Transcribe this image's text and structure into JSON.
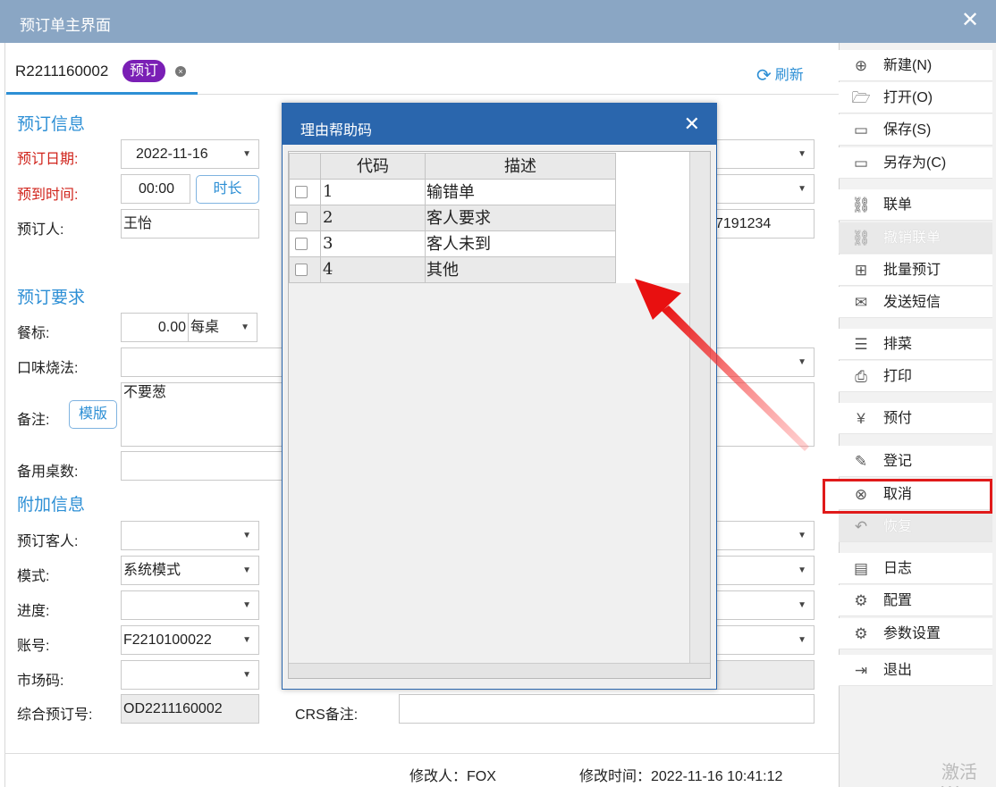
{
  "window": {
    "title": "预订单主界面",
    "close_glyph": "✕"
  },
  "tab": {
    "order_no": "R2211160002",
    "status": "预订",
    "close_glyph": "×"
  },
  "refresh_label": "刷新",
  "sections": {
    "info": "预订信息",
    "require": "预订要求",
    "extra": "附加信息"
  },
  "form": {
    "date_label": "预订日期:",
    "date_value": "2022-11-16",
    "arrive_label": "预到时间:",
    "arrive_value": "00:00",
    "duration_btn": "时长",
    "booker_label": "预订人:",
    "booker_value": "王怡",
    "phone_value": "7191234",
    "meal_label": "餐标:",
    "meal_value": "0.00",
    "meal_unit": "每桌",
    "taste_label": "口味烧法:",
    "remark_label": "备注:",
    "template_btn": "模版",
    "remark_value": "不要葱",
    "spare_label": "备用桌数:",
    "guest_label": "预订客人:",
    "mode_label": "模式:",
    "mode_value": "系统模式",
    "progress_label": "进度:",
    "account_label": "账号:",
    "account_value": "F2210100022",
    "market_label": "市场码:",
    "combo_label": "综合预订号:",
    "combo_value": "OD2211160002",
    "crs_label": "CRS备注:"
  },
  "footer": {
    "modifier": "修改人：FOX",
    "modified_time": "修改时间：2022-11-16 10:41:12"
  },
  "watermark": "激活 W",
  "sidebar": [
    {
      "label": "新建(N)",
      "icon": "⊕",
      "icon_name": "plus-circle-icon",
      "disabled": false
    },
    {
      "label": "打开(O)",
      "icon": "🗁",
      "icon_name": "folder-open-icon",
      "disabled": false
    },
    {
      "label": "保存(S)",
      "icon": "▭",
      "icon_name": "save-icon",
      "disabled": false
    },
    {
      "label": "另存为(C)",
      "icon": "▭",
      "icon_name": "save-as-icon",
      "disabled": false
    },
    {
      "label": "联单",
      "icon": "⛓",
      "icon_name": "link-icon",
      "disabled": false
    },
    {
      "label": "撤销联单",
      "icon": "⛓",
      "icon_name": "unlink-icon",
      "disabled": true
    },
    {
      "label": "批量预订",
      "icon": "⊞",
      "icon_name": "batch-icon",
      "disabled": false
    },
    {
      "label": "发送短信",
      "icon": "✉",
      "icon_name": "mail-icon",
      "disabled": false
    },
    {
      "label": "排菜",
      "icon": "☰",
      "icon_name": "menu-list-icon",
      "disabled": false
    },
    {
      "label": "打印",
      "icon": "⎙",
      "icon_name": "print-icon",
      "disabled": false
    },
    {
      "label": "预付",
      "icon": "¥",
      "icon_name": "prepay-icon",
      "disabled": false
    },
    {
      "label": "登记",
      "icon": "✎",
      "icon_name": "register-icon",
      "disabled": false
    },
    {
      "label": "取消",
      "icon": "⊗",
      "icon_name": "cancel-circle-icon",
      "disabled": false
    },
    {
      "label": "恢复",
      "icon": "↶",
      "icon_name": "restore-icon",
      "disabled": true
    },
    {
      "label": "日志",
      "icon": "▤",
      "icon_name": "log-icon",
      "disabled": false
    },
    {
      "label": "配置",
      "icon": "⚙",
      "icon_name": "config-gear-icon",
      "disabled": false
    },
    {
      "label": "参数设置",
      "icon": "⚙",
      "icon_name": "settings-gear-icon",
      "disabled": false
    },
    {
      "label": "退出",
      "icon": "⇥",
      "icon_name": "exit-icon",
      "disabled": false
    }
  ],
  "dialog": {
    "title": "理由帮助码",
    "close_glyph": "✕",
    "headers": {
      "code": "代码",
      "desc": "描述"
    },
    "rows": [
      {
        "code": "1",
        "desc": "输错单"
      },
      {
        "code": "2",
        "desc": "客人要求"
      },
      {
        "code": "3",
        "desc": "客人未到"
      },
      {
        "code": "4",
        "desc": "其他"
      }
    ]
  },
  "colors": {
    "accent": "#2d8fd5",
    "dialog_title": "#2a66ad",
    "badge": "#7a1fb5",
    "highlight": "#e01a1a",
    "required_label": "#d0231b"
  }
}
